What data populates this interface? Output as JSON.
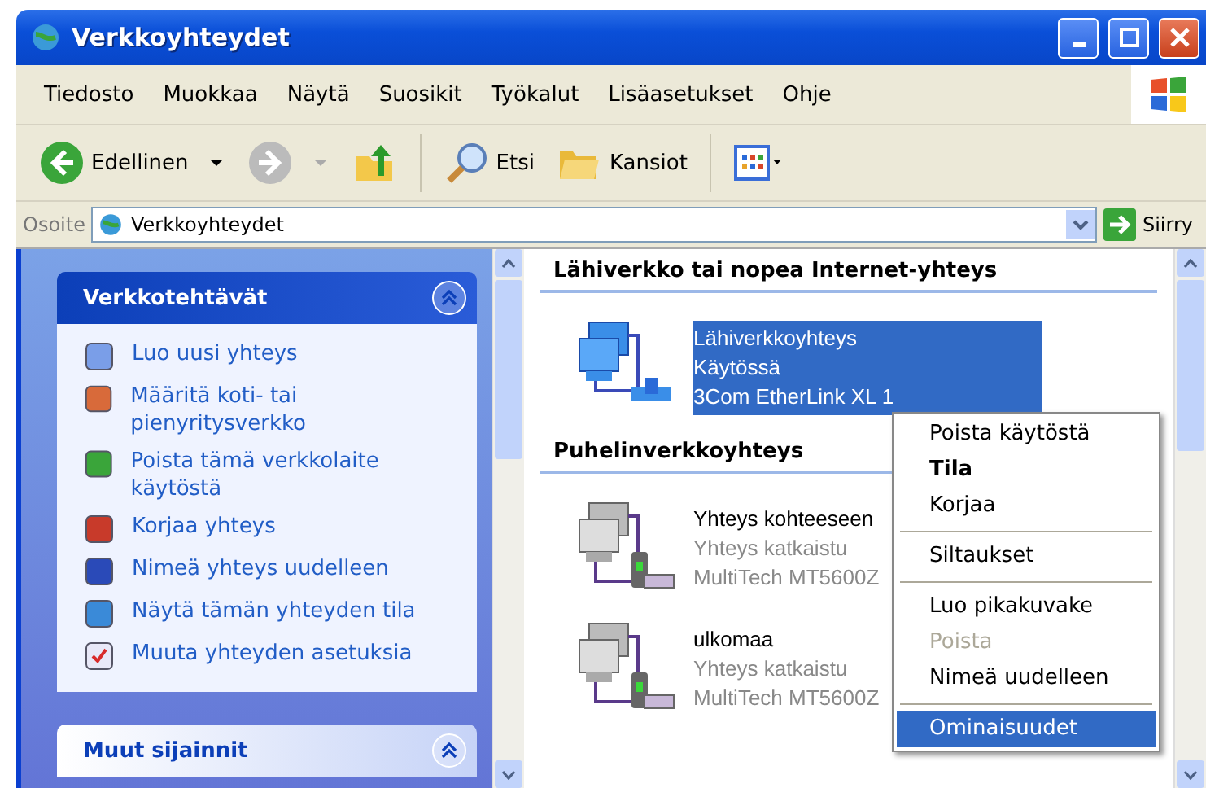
{
  "window": {
    "title": "Verkkoyhteydet"
  },
  "menu_bar": [
    "Tiedosto",
    "Muokkaa",
    "Näytä",
    "Suosikit",
    "Työkalut",
    "Lisäasetukset",
    "Ohje"
  ],
  "toolbar": [
    {
      "kind": "back",
      "label": "Edellinen",
      "disabled": false
    },
    {
      "kind": "forward",
      "disabled": true
    },
    {
      "kind": "up"
    },
    {
      "kind": "search",
      "label": "Etsi"
    },
    {
      "kind": "folders",
      "label": "Kansiot"
    },
    {
      "kind": "views"
    }
  ],
  "address": {
    "label": "Osoite",
    "value": "Verkkoyhteydet",
    "go": "Siirry"
  },
  "task_panels": [
    {
      "title": "Verkkotehtävät",
      "expanded": true,
      "items": [
        {
          "kind": "new",
          "label": "Luo uusi yhteys"
        },
        {
          "kind": "home",
          "label": "Määritä koti- tai pienyritysverkko"
        },
        {
          "kind": "disable",
          "label": "Poista tämä verkkolaite käytöstä"
        },
        {
          "kind": "repair",
          "label": "Korjaa yhteys"
        },
        {
          "kind": "rename",
          "label": "Nimeä yhteys uudelleen"
        },
        {
          "kind": "status",
          "label": "Näytä tämän yhteyden tila"
        },
        {
          "kind": "settings",
          "label": "Muuta yhteyden asetuksia"
        }
      ]
    },
    {
      "title": "Muut sijainnit",
      "expanded": true
    }
  ],
  "groups": [
    {
      "title": "Lähiverkko tai nopea Internet-yhteys",
      "connections": [
        {
          "kind": "lan",
          "name": "Lähiverkkoyhteys",
          "status": "Käytössä",
          "device": "3Com EtherLink XL 1",
          "selected": true,
          "connected": true
        }
      ]
    },
    {
      "title": "Puhelinverkkoyhteys",
      "connections": [
        {
          "kind": "dialup",
          "name": "Yhteys kohteeseen",
          "status": "Yhteys katkaistu",
          "device": "MultiTech MT5600Z",
          "selected": false,
          "connected": false
        },
        {
          "kind": "dialup",
          "name": "ulkomaa",
          "status": "Yhteys katkaistu",
          "device": "MultiTech MT5600Z",
          "selected": false,
          "connected": false
        }
      ]
    }
  ],
  "context_menu": [
    {
      "kind": "item",
      "label": "Poista käytöstä",
      "default": false,
      "disabled": false,
      "selected": false
    },
    {
      "kind": "item",
      "label": "Tila",
      "default": true,
      "disabled": false,
      "selected": false
    },
    {
      "kind": "item",
      "label": "Korjaa",
      "default": false,
      "disabled": false,
      "selected": false
    },
    {
      "kind": "separator"
    },
    {
      "kind": "item",
      "label": "Siltaukset",
      "default": false,
      "disabled": false,
      "selected": false
    },
    {
      "kind": "separator"
    },
    {
      "kind": "item",
      "label": "Luo pikakuvake",
      "default": false,
      "disabled": false,
      "selected": false
    },
    {
      "kind": "item",
      "label": "Poista",
      "default": false,
      "disabled": true,
      "selected": false
    },
    {
      "kind": "item",
      "label": "Nimeä uudelleen",
      "default": false,
      "disabled": false,
      "selected": false
    },
    {
      "kind": "separator"
    },
    {
      "kind": "item",
      "label": "Ominaisuudet",
      "default": false,
      "disabled": false,
      "selected": true
    }
  ]
}
